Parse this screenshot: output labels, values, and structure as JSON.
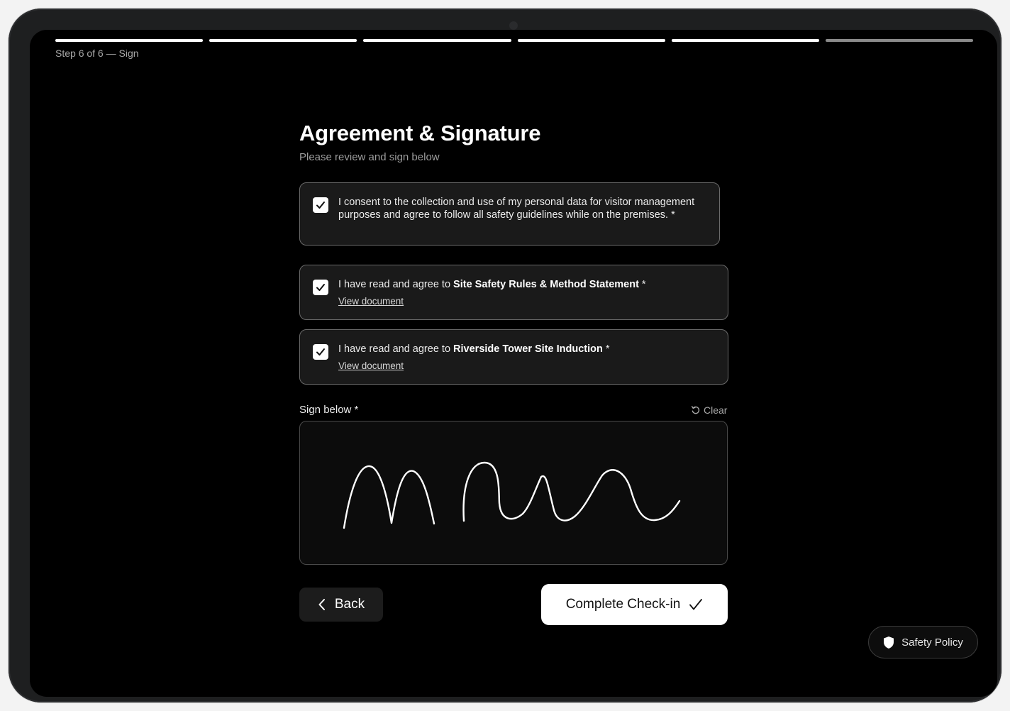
{
  "progress": {
    "total_steps": 6,
    "current_step": 6,
    "label": "Step 6 of 6 — Sign"
  },
  "page": {
    "title": "Agreement & Signature",
    "subtitle": "Please review and sign below"
  },
  "consent": {
    "checked": true,
    "text": "I consent to the collection and use of my personal data for visitor management purposes and agree to follow all safety guidelines while on the premises. *"
  },
  "documents": [
    {
      "checked": true,
      "prefix": "I have read and agree to ",
      "name": "Site Safety Rules & Method Statement",
      "suffix": " *",
      "link": "View document"
    },
    {
      "checked": true,
      "prefix": "I have read and agree to ",
      "name": "Riverside Tower Site Induction",
      "suffix": " *",
      "link": "View document"
    }
  ],
  "signature": {
    "label": "Sign below *",
    "clear_label": "Clear",
    "has_signature": true
  },
  "actions": {
    "back_label": "Back",
    "complete_label": "Complete Check-in"
  },
  "floating": {
    "safety_policy_label": "Safety Policy"
  },
  "icons": {
    "checkbox": "check-icon",
    "clear": "undo-icon",
    "back": "chevron-left-icon",
    "complete": "checkmark-icon",
    "safety": "shield-icon"
  },
  "colors": {
    "background": "#000000",
    "primary_button": "#ffffff",
    "card": "#1a1a1a"
  }
}
